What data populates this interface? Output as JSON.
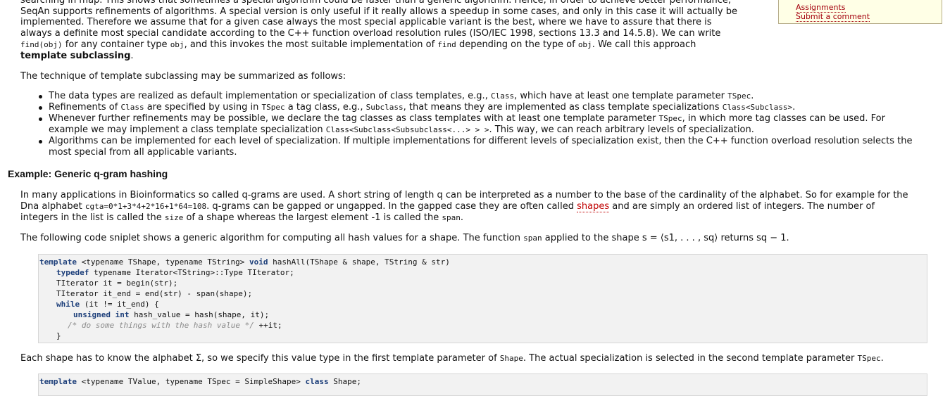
{
  "intro": {
    "line0": "searching in map. This shows that sometimes a special algorithm could be faster than a generic algorithm. Hence, in order to achieve better performance,",
    "line1": "SeqAn supports refinements of algorithms. A special version is only useful if it really allows a speedup in some cases, and only in this case it will actually be",
    "line2": "implemented. Therefore we assume that for a given case always the most special applicable variant is the best, where we have to assure that there is",
    "line3": "always a definite most special candidate according to the C++ function overload resolution rules (ISO/IEC 1998, sections 13.3 and 14.5.8). We can write",
    "line4_code1": "find(obj)",
    "line4_text1": " for any container type ",
    "line4_code2": "obj",
    "line4_text2": ", and this invokes the most suitable implementation of ",
    "line4_code3": "find",
    "line4_text3": " depending on the type of ",
    "line4_code4": "obj",
    "line4_text4": ". We call this approach",
    "line5_bold": "template subclassing",
    "line5_end": "."
  },
  "sidebar": {
    "link_assignments": "Assignments",
    "link_comment": "Submit a comment"
  },
  "summary": {
    "lead": "The technique of template subclassing may be summarized as follows:",
    "b1": {
      "t1": "The data types are realized as default implementation or specialization of class templates, e.g., ",
      "c1": "Class",
      "t2": ", which have at least one template parameter ",
      "c2": "TSpec",
      "t3": "."
    },
    "b2": {
      "t1": "Refinements of ",
      "c1": "Class",
      "t2": " are specified by using in ",
      "c2": "TSpec",
      "t3": " a tag class, e.g., ",
      "c3": "Subclass",
      "t4": ", that means they are implemented as class template specializations ",
      "c4": "Class<Subclass>",
      "t5": "."
    },
    "b3": {
      "t1": "Whenever further refinements may be possible, we declare the tag classes as class templates with at least one template parameter ",
      "c1": "TSpec",
      "t2": ", in which more tag classes can be used. For",
      "t3": "example we may implement a class template specialization ",
      "c2": "Class<Subclass<Subsubclass<...> > >",
      "t4": ". This way, we can reach arbitrary levels of specialization."
    },
    "b4": {
      "l1": "Algorithms can be implemented for each level of specialization. If multiple implementations for different levels of specialization exist, then the C++ function overload resolution selects the",
      "l2": "most special from all applicable variants."
    }
  },
  "example": {
    "heading": "Example: Generic q-gram hashing",
    "p1": {
      "l1": "In many applications in Bioinformatics so called q-grams are used. A short string of length q can be interpreted as a number to the base of the cardinality of the alphabet. So for example for the",
      "l2_t1": "Dna alphabet ",
      "l2_c1": "cgta=0*1+3*4+2*16+1*64=108",
      "l2_t2": ". q-grams can be gapped or ungapped. In the gapped case they are often called ",
      "l2_link": "shapes",
      "l2_t3": " and are simply an ordered list of integers. The number of",
      "l3_t1": "integers in the list is called the ",
      "l3_c1": "size",
      "l3_t2": " of a shape whereas the largest element -1 is called the ",
      "l3_c2": "span",
      "l3_t3": "."
    },
    "p2": {
      "t1": "The following code sniplet shows a generic algorithm for computing all hash values for a shape. The function ",
      "c1": "span",
      "t2": " applied to the shape s = ⟨s1, . . . , sq⟩ returns sq − 1."
    },
    "code1": {
      "l1_kw": "template",
      "l1_rest": " <typename TShape, typename TString> ",
      "l1_kw2": "void",
      "l1_rest2": " hashAll(TShape & shape, TString & str)",
      "l2_kw": "typedef",
      "l2_rest": " typename Iterator<TString>::Type TIterator;",
      "l3": "TIterator it = begin(str);",
      "l4": "TIterator it_end = end(str) - span(shape);",
      "l5_kw": "while",
      "l5_rest": " (it != it_end) {",
      "l6_kw": "unsigned int",
      "l6_rest": " hash_value = hash(shape, it);",
      "l7_cm": "/* do some things with the hash value */",
      "l7_rest": " ++it;",
      "l8": "}"
    },
    "p3": {
      "t1": "Each shape has to know the alphabet Σ, so we specify this value type in the first template parameter of ",
      "c1": "Shape",
      "t2": ". The actual specialization is selected in the second template parameter ",
      "c2": "TSpec",
      "t3": "."
    },
    "code2": {
      "l1_kw": "template",
      "l1_rest": " <typename TValue, typename TSpec = SimpleShape> ",
      "l1_kw2": "class",
      "l1_rest2": " Shape;"
    }
  }
}
